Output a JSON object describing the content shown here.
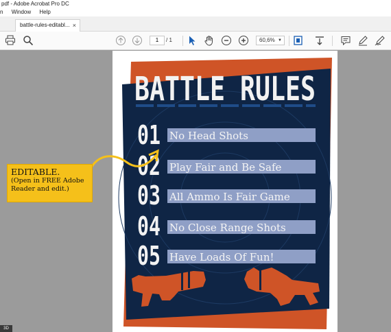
{
  "window": {
    "title": "pdf - Adobe Acrobat Pro DC"
  },
  "menu": {
    "items": [
      "n",
      "Window",
      "Help"
    ]
  },
  "tab": {
    "label": "battle-rules-editabl...",
    "close": "×"
  },
  "toolbar": {
    "icons": [
      "print-icon",
      "search-icon",
      "prev-page-icon",
      "next-page-icon",
      "select-icon",
      "hand-icon",
      "zoom-out-icon",
      "zoom-in-icon",
      "fit-icon",
      "scroll-icon",
      "comment-icon",
      "pen-icon",
      "sign-icon"
    ],
    "page_current": "1",
    "page_total": "/ 1",
    "zoom": "60,6%"
  },
  "poster": {
    "title": "BATTLE RULES",
    "rules": [
      {
        "num": "01",
        "text": "No Head Shots"
      },
      {
        "num": "02",
        "text": "Play Fair and Be Safe"
      },
      {
        "num": "03",
        "text": "All Ammo Is Fair Game"
      },
      {
        "num": "04",
        "text": "No Close Range Shots"
      },
      {
        "num": "05",
        "text": "Have Loads Of Fun!"
      }
    ],
    "colors": {
      "orange": "#cf5427",
      "navy": "#0f2545",
      "field": "#8f9fc6",
      "white": "#f2f2f2"
    }
  },
  "callout": {
    "heading": "EDITABLE.",
    "line1": "(Open in FREE Adobe",
    "line2": "Reader and edit.)",
    "color": "#f5c01a"
  },
  "corner": {
    "label": "3D"
  }
}
